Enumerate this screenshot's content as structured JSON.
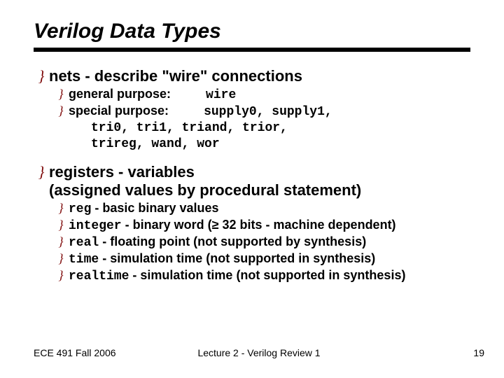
{
  "title": "Verilog Data Types",
  "bullet_mark": "}",
  "sections": {
    "nets": {
      "heading": "nets - describe \"wire\" connections",
      "items": {
        "general": {
          "label": "general purpose:",
          "types": "wire"
        },
        "special": {
          "label": "special purpose:",
          "types0": "supply0, supply1,",
          "types1": "tri0, tri1, triand, trior,",
          "types2": "trireg, wand, wor"
        }
      }
    },
    "registers": {
      "heading": "registers - variables\n(assigned values by procedural statement)",
      "items": {
        "reg": {
          "kw": "reg",
          "desc": " - basic binary values"
        },
        "integer": {
          "kw": "integer",
          "desc": " - binary word (≥ 32 bits - machine dependent)"
        },
        "real": {
          "kw": "real",
          "desc": " - floating point (not supported by synthesis)"
        },
        "time": {
          "kw": "time",
          "desc": " - simulation time (not supported in synthesis)"
        },
        "realtime": {
          "kw": "realtime",
          "desc": " - simulation time (not supported in synthesis)"
        }
      }
    }
  },
  "footer": {
    "left": "ECE 491 Fall 2006",
    "center": "Lecture 2 - Verilog Review 1",
    "right": "19"
  }
}
